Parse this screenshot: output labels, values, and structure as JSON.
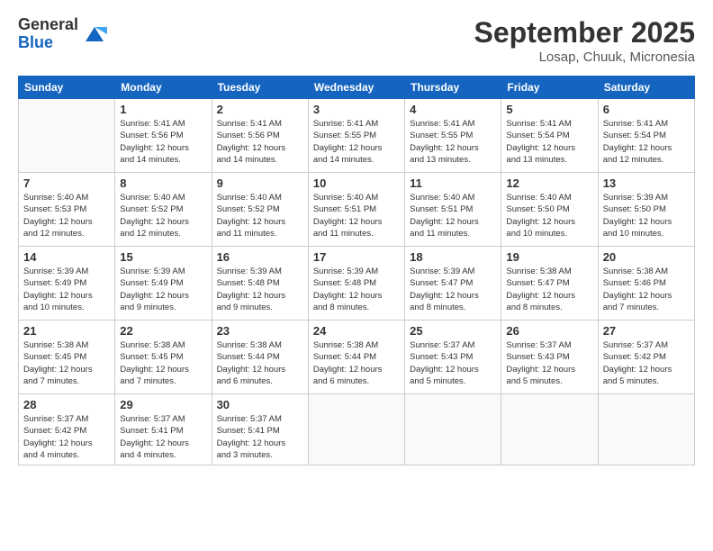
{
  "logo": {
    "general": "General",
    "blue": "Blue"
  },
  "title": "September 2025",
  "location": "Losap, Chuuk, Micronesia",
  "days_of_week": [
    "Sunday",
    "Monday",
    "Tuesday",
    "Wednesday",
    "Thursday",
    "Friday",
    "Saturday"
  ],
  "weeks": [
    [
      {
        "day": "",
        "info": ""
      },
      {
        "day": "1",
        "info": "Sunrise: 5:41 AM\nSunset: 5:56 PM\nDaylight: 12 hours\nand 14 minutes."
      },
      {
        "day": "2",
        "info": "Sunrise: 5:41 AM\nSunset: 5:56 PM\nDaylight: 12 hours\nand 14 minutes."
      },
      {
        "day": "3",
        "info": "Sunrise: 5:41 AM\nSunset: 5:55 PM\nDaylight: 12 hours\nand 14 minutes."
      },
      {
        "day": "4",
        "info": "Sunrise: 5:41 AM\nSunset: 5:55 PM\nDaylight: 12 hours\nand 13 minutes."
      },
      {
        "day": "5",
        "info": "Sunrise: 5:41 AM\nSunset: 5:54 PM\nDaylight: 12 hours\nand 13 minutes."
      },
      {
        "day": "6",
        "info": "Sunrise: 5:41 AM\nSunset: 5:54 PM\nDaylight: 12 hours\nand 12 minutes."
      }
    ],
    [
      {
        "day": "7",
        "info": "Sunrise: 5:40 AM\nSunset: 5:53 PM\nDaylight: 12 hours\nand 12 minutes."
      },
      {
        "day": "8",
        "info": "Sunrise: 5:40 AM\nSunset: 5:52 PM\nDaylight: 12 hours\nand 12 minutes."
      },
      {
        "day": "9",
        "info": "Sunrise: 5:40 AM\nSunset: 5:52 PM\nDaylight: 12 hours\nand 11 minutes."
      },
      {
        "day": "10",
        "info": "Sunrise: 5:40 AM\nSunset: 5:51 PM\nDaylight: 12 hours\nand 11 minutes."
      },
      {
        "day": "11",
        "info": "Sunrise: 5:40 AM\nSunset: 5:51 PM\nDaylight: 12 hours\nand 11 minutes."
      },
      {
        "day": "12",
        "info": "Sunrise: 5:40 AM\nSunset: 5:50 PM\nDaylight: 12 hours\nand 10 minutes."
      },
      {
        "day": "13",
        "info": "Sunrise: 5:39 AM\nSunset: 5:50 PM\nDaylight: 12 hours\nand 10 minutes."
      }
    ],
    [
      {
        "day": "14",
        "info": "Sunrise: 5:39 AM\nSunset: 5:49 PM\nDaylight: 12 hours\nand 10 minutes."
      },
      {
        "day": "15",
        "info": "Sunrise: 5:39 AM\nSunset: 5:49 PM\nDaylight: 12 hours\nand 9 minutes."
      },
      {
        "day": "16",
        "info": "Sunrise: 5:39 AM\nSunset: 5:48 PM\nDaylight: 12 hours\nand 9 minutes."
      },
      {
        "day": "17",
        "info": "Sunrise: 5:39 AM\nSunset: 5:48 PM\nDaylight: 12 hours\nand 8 minutes."
      },
      {
        "day": "18",
        "info": "Sunrise: 5:39 AM\nSunset: 5:47 PM\nDaylight: 12 hours\nand 8 minutes."
      },
      {
        "day": "19",
        "info": "Sunrise: 5:38 AM\nSunset: 5:47 PM\nDaylight: 12 hours\nand 8 minutes."
      },
      {
        "day": "20",
        "info": "Sunrise: 5:38 AM\nSunset: 5:46 PM\nDaylight: 12 hours\nand 7 minutes."
      }
    ],
    [
      {
        "day": "21",
        "info": "Sunrise: 5:38 AM\nSunset: 5:45 PM\nDaylight: 12 hours\nand 7 minutes."
      },
      {
        "day": "22",
        "info": "Sunrise: 5:38 AM\nSunset: 5:45 PM\nDaylight: 12 hours\nand 7 minutes."
      },
      {
        "day": "23",
        "info": "Sunrise: 5:38 AM\nSunset: 5:44 PM\nDaylight: 12 hours\nand 6 minutes."
      },
      {
        "day": "24",
        "info": "Sunrise: 5:38 AM\nSunset: 5:44 PM\nDaylight: 12 hours\nand 6 minutes."
      },
      {
        "day": "25",
        "info": "Sunrise: 5:37 AM\nSunset: 5:43 PM\nDaylight: 12 hours\nand 5 minutes."
      },
      {
        "day": "26",
        "info": "Sunrise: 5:37 AM\nSunset: 5:43 PM\nDaylight: 12 hours\nand 5 minutes."
      },
      {
        "day": "27",
        "info": "Sunrise: 5:37 AM\nSunset: 5:42 PM\nDaylight: 12 hours\nand 5 minutes."
      }
    ],
    [
      {
        "day": "28",
        "info": "Sunrise: 5:37 AM\nSunset: 5:42 PM\nDaylight: 12 hours\nand 4 minutes."
      },
      {
        "day": "29",
        "info": "Sunrise: 5:37 AM\nSunset: 5:41 PM\nDaylight: 12 hours\nand 4 minutes."
      },
      {
        "day": "30",
        "info": "Sunrise: 5:37 AM\nSunset: 5:41 PM\nDaylight: 12 hours\nand 3 minutes."
      },
      {
        "day": "",
        "info": ""
      },
      {
        "day": "",
        "info": ""
      },
      {
        "day": "",
        "info": ""
      },
      {
        "day": "",
        "info": ""
      }
    ]
  ]
}
